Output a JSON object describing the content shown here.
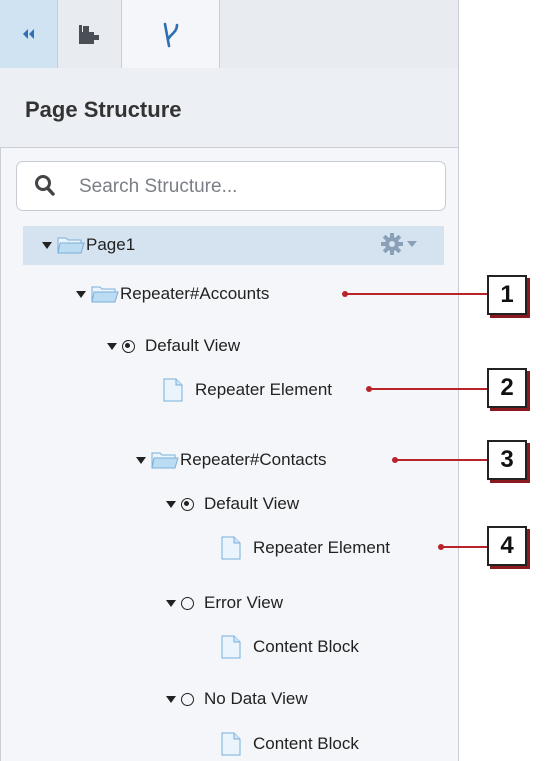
{
  "tabs": [
    {
      "name": "collapse",
      "icon": "double-chevron-left-icon"
    },
    {
      "name": "components",
      "icon": "puzzle-piece-icon"
    },
    {
      "name": "page-structure",
      "icon": "branch-icon"
    }
  ],
  "panel": {
    "title": "Page Structure"
  },
  "search": {
    "placeholder": "Search Structure...",
    "icon": "search-icon"
  },
  "tree": {
    "page": {
      "label": "Page1",
      "icon": "folder-icon",
      "menu_icon": "gear-icon"
    },
    "repeater_accounts": {
      "label": "Repeater#Accounts",
      "icon": "folder-icon"
    },
    "accounts_default_view": {
      "label": "Default View",
      "selected": true
    },
    "accounts_repeater_element": {
      "label": "Repeater Element",
      "icon": "page-icon"
    },
    "repeater_contacts": {
      "label": "Repeater#Contacts",
      "icon": "folder-icon"
    },
    "contacts_default_view": {
      "label": "Default View",
      "selected": true
    },
    "contacts_repeater_element": {
      "label": "Repeater Element",
      "icon": "page-icon"
    },
    "contacts_error_view": {
      "label": "Error View",
      "selected": false
    },
    "error_content_block": {
      "label": "Content Block",
      "icon": "page-icon"
    },
    "contacts_no_data_view": {
      "label": "No Data View",
      "selected": false
    },
    "no_data_content_block": {
      "label": "Content Block",
      "icon": "page-icon"
    }
  },
  "callouts": [
    "1",
    "2",
    "3",
    "4"
  ],
  "colors": {
    "accent": "#b8232a",
    "selected_row": "#d5e2ef",
    "folder": "#a9cde9",
    "panel_bg": "#f4f6f9"
  }
}
